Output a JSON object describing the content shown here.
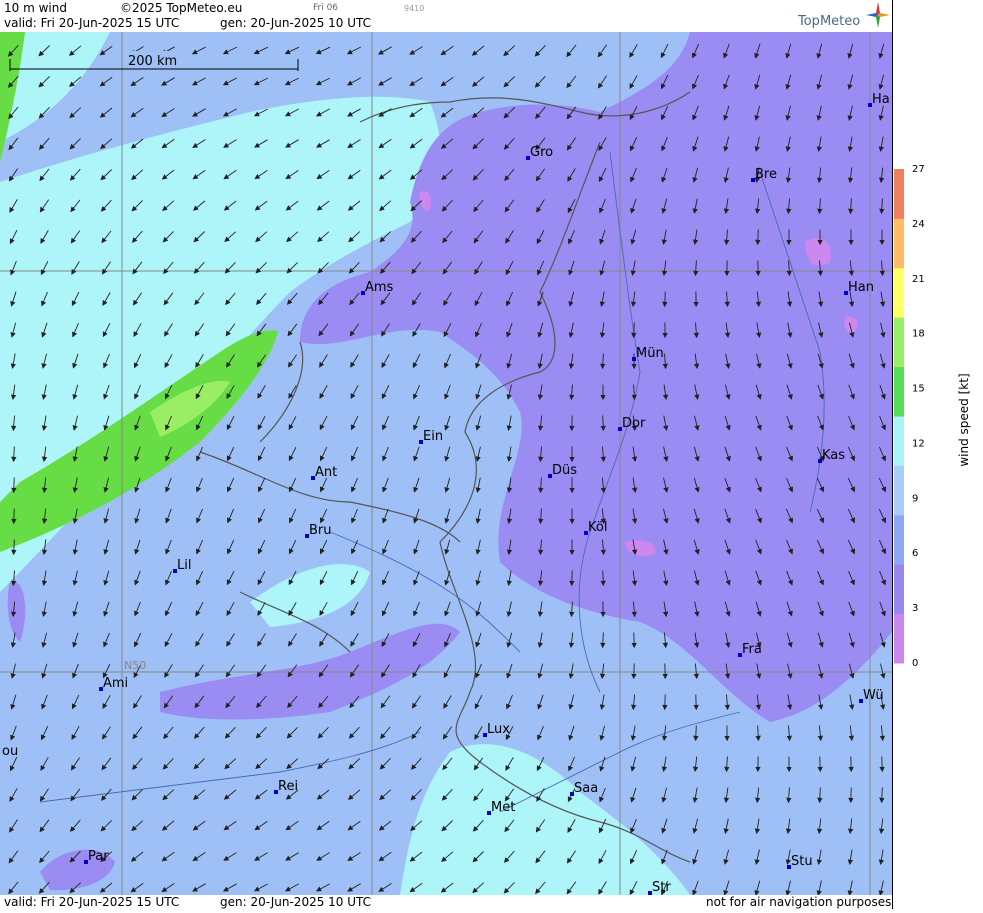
{
  "header": {
    "product": "10 m wind",
    "copyright": "©2025 TopMeteo.eu",
    "run_label": "Fri 06",
    "code": "9410",
    "valid": "valid:  Fri  20-Jun-2025  15 UTC",
    "gen": "gen: 20-Jun-2025 10 UTC",
    "logo": "TopMeteo"
  },
  "footer": {
    "valid": "valid:  Fri  20-Jun-2025  15 UTC",
    "gen": "gen: 20-Jun-2025 10 UTC",
    "disclaimer": "not for air navigation purposes"
  },
  "map": {
    "scale_label": "200 km",
    "lat_label": "N50",
    "cities": [
      {
        "name": "Gro"
      },
      {
        "name": "Bre"
      },
      {
        "name": "Ha"
      },
      {
        "name": "Ams"
      },
      {
        "name": "Han"
      },
      {
        "name": "Mün"
      },
      {
        "name": "Dor"
      },
      {
        "name": "Ein"
      },
      {
        "name": "Kas"
      },
      {
        "name": "Düs"
      },
      {
        "name": "Ant"
      },
      {
        "name": "Köl"
      },
      {
        "name": "Bru"
      },
      {
        "name": "Lil"
      },
      {
        "name": "Fra"
      },
      {
        "name": "Ami"
      },
      {
        "name": "Wü"
      },
      {
        "name": "Lux"
      },
      {
        "name": "ou"
      },
      {
        "name": "Rei"
      },
      {
        "name": "Saa"
      },
      {
        "name": "Met"
      },
      {
        "name": "Par"
      },
      {
        "name": "Stu"
      },
      {
        "name": "Str"
      }
    ]
  },
  "legend": {
    "title": "wind speed  [kt]",
    "ticks": [
      "0",
      "3",
      "6",
      "9",
      "12",
      "15",
      "18",
      "21",
      "24",
      "27"
    ],
    "colors": [
      "#cc88ee",
      "#9988f0",
      "#8ea8f5",
      "#aaccf8",
      "#aaf4f8",
      "#55dd55",
      "#99ee66",
      "#ffff66",
      "#ffbb66",
      "#f08060"
    ]
  },
  "colors": {
    "light_blue": "#9ec0f6",
    "cyan": "#adf5f8",
    "purple": "#9a8cf2",
    "pink": "#cc88ee",
    "green": "#66dd44",
    "city_marker": "#0000cc"
  }
}
